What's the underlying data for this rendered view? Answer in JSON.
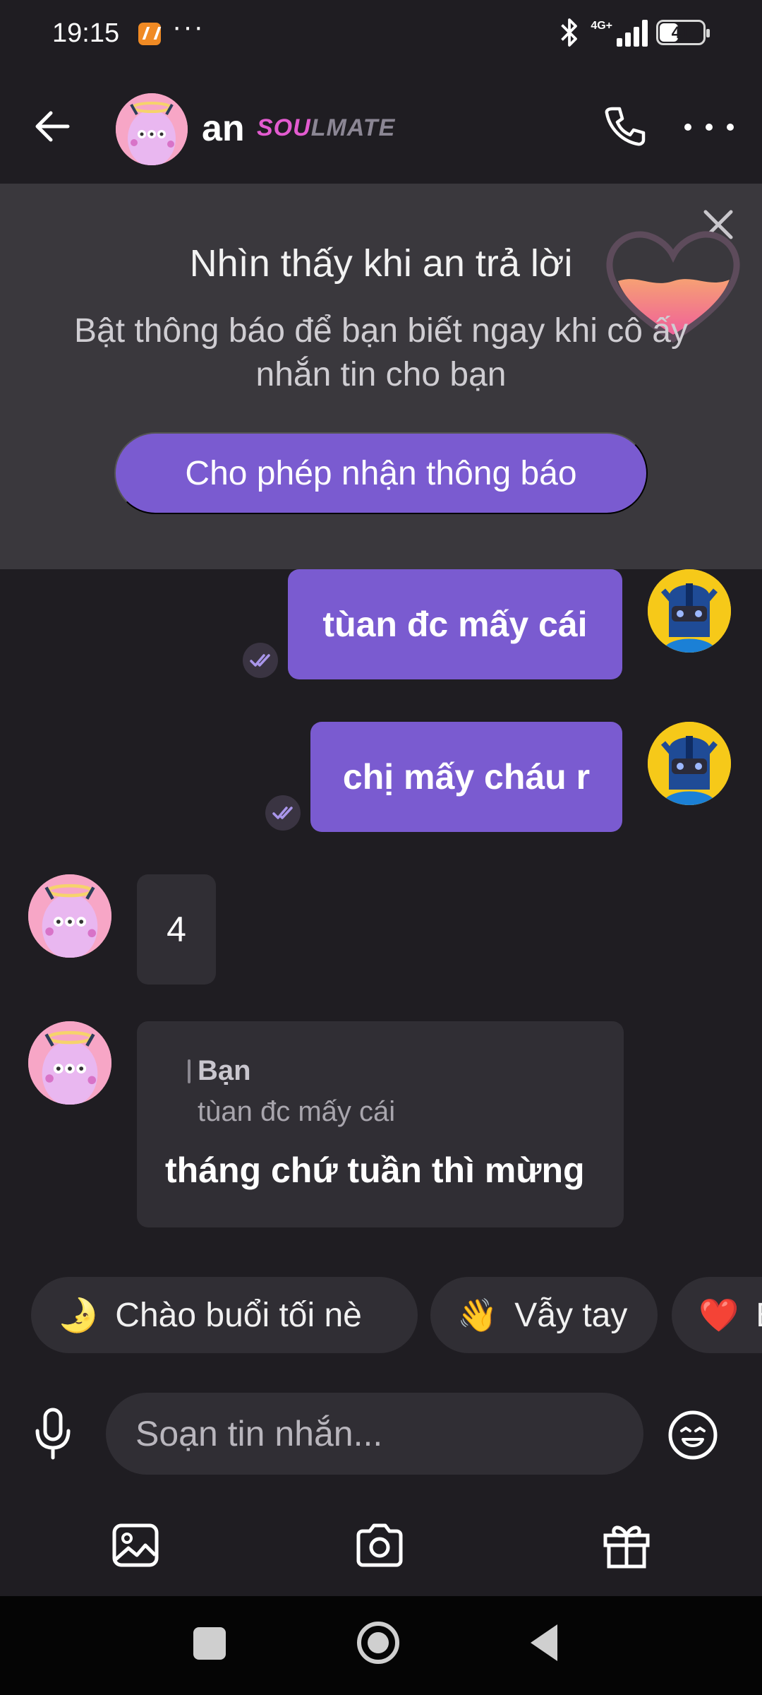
{
  "status_bar": {
    "time": "19:15",
    "dots": "···",
    "network": "4G+",
    "battery_text": "41"
  },
  "header": {
    "contact_name": "an",
    "badge_part1": "SOU",
    "badge_part2": "LMATE"
  },
  "banner": {
    "title": "Nhìn thấy khi an trả lời",
    "subtitle": "Bật thông báo để bạn biết ngay khi cô ấy nhắn tin cho bạn",
    "button_label": "Cho phép nhận thông báo"
  },
  "messages": {
    "out_1": "tùan đc mấy cái",
    "out_2": "chị mấy cháu r",
    "in_1": "4",
    "in_2_quote_author": "Bạn",
    "in_2_quote_text": "tùan đc mấy cái",
    "in_2_text": "tháng chứ tuần thì mừng"
  },
  "quick_replies": [
    {
      "emoji": "🌛",
      "label": "Chào buổi tối nè"
    },
    {
      "emoji": "👋",
      "label": "Vẫy tay"
    },
    {
      "emoji": "❤️",
      "label": "B"
    }
  ],
  "composer": {
    "placeholder": "Soạn tin nhắn..."
  },
  "icons": {
    "back": "arrow-left-icon",
    "call": "phone-icon",
    "more": "more-horizontal-icon",
    "close": "close-icon",
    "mic": "mic-icon",
    "emoji": "emoji-icon",
    "gallery": "image-icon",
    "camera": "camera-icon",
    "gift": "gift-icon"
  },
  "colors": {
    "background": "#1f1d22",
    "banner": "#3a383d",
    "accent": "#7a5bd0",
    "bubble_in": "#302e34",
    "soulmate_pink": "#e35bd0"
  }
}
